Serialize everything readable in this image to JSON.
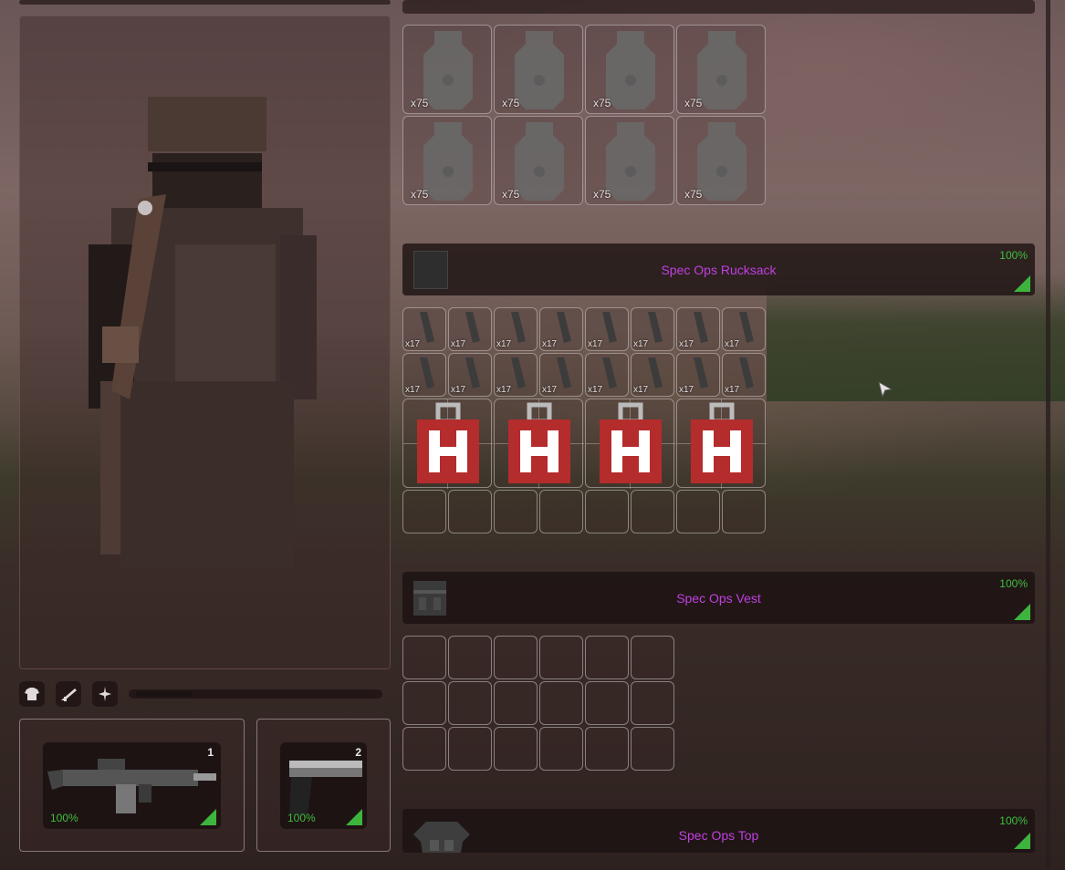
{
  "colors": {
    "item_name": "#c040e0",
    "quality": "#3fbf3f",
    "panel": "#261818"
  },
  "ammo_boxes": {
    "slots": [
      {
        "qty": "x75"
      },
      {
        "qty": "x75"
      },
      {
        "qty": "x75"
      },
      {
        "qty": "x75"
      },
      {
        "qty": "x75"
      },
      {
        "qty": "x75"
      },
      {
        "qty": "x75"
      },
      {
        "qty": "x75"
      }
    ]
  },
  "rucksack": {
    "name": "Spec Ops Rucksack",
    "quality": "100%",
    "icon": "rucksack-icon"
  },
  "rucksack_grid": {
    "mag_qty": "x17",
    "mag_count": 16,
    "medkit_count": 4,
    "empty_count": 8
  },
  "vest": {
    "name": "Spec Ops Vest",
    "quality": "100%",
    "icon": "vest-icon",
    "empty_slots": 18
  },
  "top": {
    "name": "Spec Ops Top",
    "quality": "100%",
    "icon": "shirt-icon"
  },
  "tabs": [
    {
      "icon": "shirt-icon"
    },
    {
      "icon": "rifle-icon"
    },
    {
      "icon": "sparkle-icon"
    }
  ],
  "primary": {
    "slot_number": "1",
    "quality": "100%",
    "icon": "assault-rifle-icon"
  },
  "secondary": {
    "slot_number": "2",
    "quality": "100%",
    "icon": "pistol-icon"
  }
}
